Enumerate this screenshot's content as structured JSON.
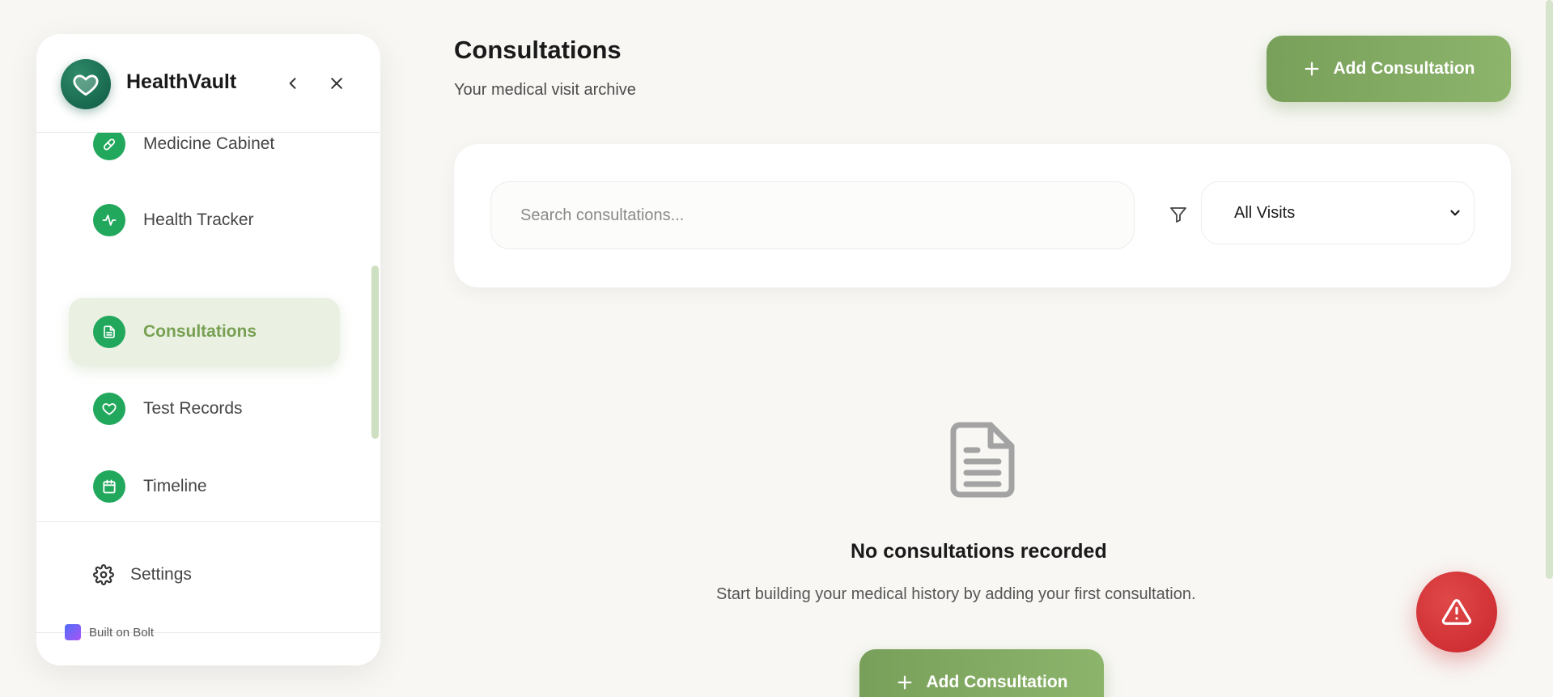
{
  "sidebar": {
    "brand": "HealthVault",
    "items": [
      {
        "label": "Medicine Cabinet",
        "icon": "pill-icon"
      },
      {
        "label": "Health Tracker",
        "icon": "activity-icon"
      },
      {
        "label": "Consultations",
        "icon": "file-text-icon",
        "active": true
      },
      {
        "label": "Test Records",
        "icon": "heart-icon"
      },
      {
        "label": "Timeline",
        "icon": "calendar-icon"
      }
    ],
    "settings_label": "Settings",
    "footer": "Built on Bolt"
  },
  "header": {
    "title": "Consultations",
    "subtitle": "Your medical visit archive",
    "add_button": "Add Consultation"
  },
  "filters": {
    "search_placeholder": "Search consultations...",
    "select_value": "All Visits"
  },
  "empty_state": {
    "title": "No consultations recorded",
    "description": "Start building your medical history by adding your first consultation.",
    "button": "Add Consultation"
  },
  "colors": {
    "accent": "#78a05a",
    "icon_green": "#22a85d",
    "logo": "#0f5a44",
    "alert": "#d0282e",
    "background": "#f8f7f4"
  }
}
